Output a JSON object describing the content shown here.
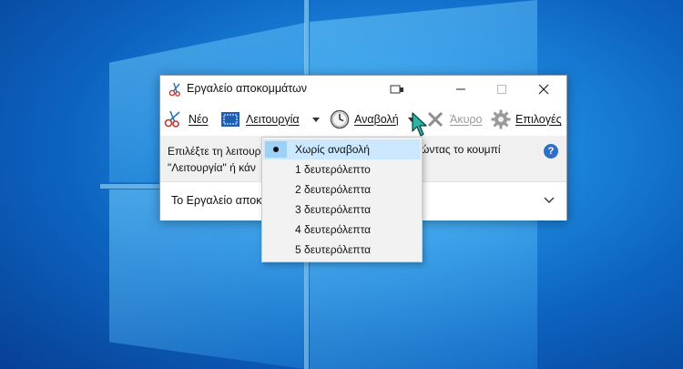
{
  "window": {
    "title": "Εργαλείο αποκομμάτων"
  },
  "toolbar": {
    "new_label": "Νέο",
    "mode_label": "Λειτουργία",
    "delay_label": "Αναβολή",
    "cancel_label": "Άκυρο",
    "options_label": "Επιλογές"
  },
  "info": {
    "line1_start": "Επιλέξτε τη λειτουρ",
    "line1_end": "ώντας το κουμπί",
    "line2_start": "\"Λειτουργία\" ή κάν"
  },
  "footer": {
    "text": "Το Εργαλείο αποκο"
  },
  "delay_menu": {
    "items": [
      {
        "label": "Χωρίς αναβολή",
        "selected": true
      },
      {
        "label": "1 δευτερόλεπτο",
        "selected": false
      },
      {
        "label": "2 δευτερόλεπτα",
        "selected": false
      },
      {
        "label": "3 δευτερόλεπτα",
        "selected": false
      },
      {
        "label": "4 δευτερόλεπτα",
        "selected": false
      },
      {
        "label": "5 δευτερόλεπτα",
        "selected": false
      }
    ]
  },
  "colors": {
    "accent": "#0078d7",
    "selection": "#cce8ff",
    "help": "#2f6fc9"
  }
}
